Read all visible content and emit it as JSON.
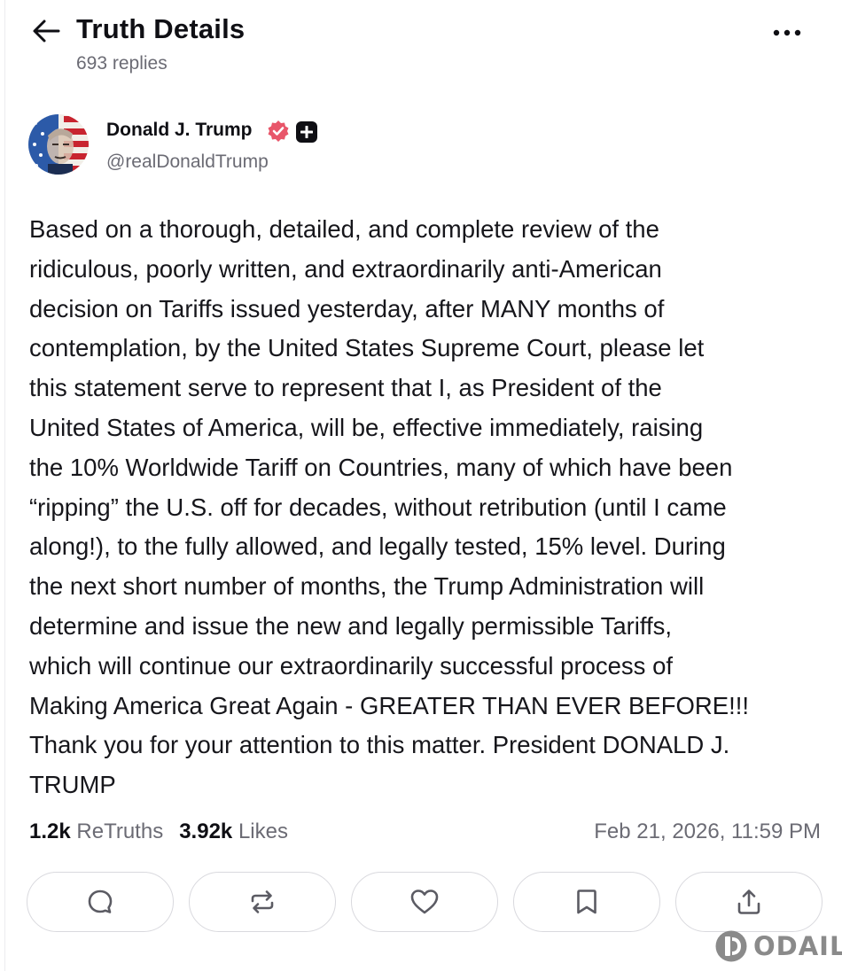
{
  "header": {
    "title": "Truth Details",
    "replies": "693 replies"
  },
  "author": {
    "name": "Donald J. Trump",
    "handle": "@realDonaldTrump",
    "verified_color": "#e8566a"
  },
  "post": {
    "text": "Based on a thorough, detailed, and complete review of the\nridiculous, poorly written, and extraordinarily anti-American\ndecision on Tariffs issued yesterday, after MANY months of\ncontemplation, by the United States Supreme Court, please let\nthis statement serve to represent that I, as President of the\nUnited States of America, will be, effective immediately, raising\nthe 10% Worldwide Tariff on Countries, many of which have been\n“ripping” the U.S. off for decades, without retribution (until I came\nalong!), to the fully allowed, and legally tested, 15% level. During\nthe next short number of months, the Trump Administration will\ndetermine and issue the new and legally permissible Tariffs,\nwhich will continue our extraordinarily successful process of\nMaking America Great Again - GREATER THAN EVER BEFORE!!!\nThank you for your attention to this matter. President DONALD J.\nTRUMP"
  },
  "stats": {
    "retruths_count": "1.2k",
    "retruths_label": "ReTruths",
    "likes_count": "3.92k",
    "likes_label": "Likes",
    "timestamp": "Feb 21, 2026, 11:59 PM"
  },
  "actions": [
    {
      "icon": "reply-icon"
    },
    {
      "icon": "retruth-icon"
    },
    {
      "icon": "heart-icon"
    },
    {
      "icon": "bookmark-icon"
    },
    {
      "icon": "share-icon"
    }
  ],
  "watermark": {
    "text": "ODAILY"
  }
}
